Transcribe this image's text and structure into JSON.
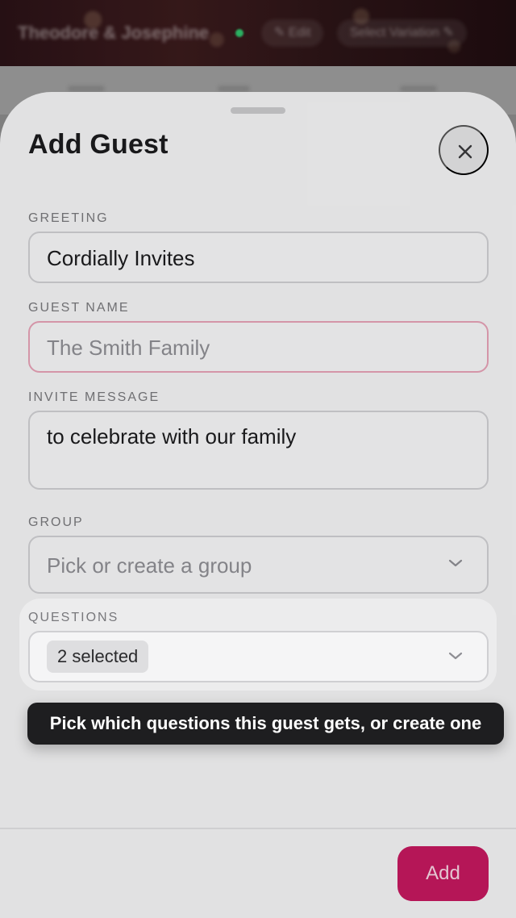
{
  "background": {
    "event_title": "Theodore & Josephine",
    "edit_label": "✎ Edit",
    "variation_label": "Select Variation ✎"
  },
  "sheet": {
    "title": "Add Guest",
    "close_icon": "close-icon",
    "fields": {
      "greeting": {
        "label": "GREETING",
        "value": "Cordially Invites"
      },
      "guest_name": {
        "label": "GUEST NAME",
        "placeholder": "The Smith Family",
        "state": "invalid"
      },
      "invite_message": {
        "label": "INVITE MESSAGE",
        "value": "to celebrate with our family"
      },
      "group": {
        "label": "GROUP",
        "placeholder": "Pick or create a group"
      },
      "questions": {
        "label": "QUESTIONS",
        "selected_chip": "2 selected"
      }
    },
    "tooltip": "Pick which questions this guest gets, or create one",
    "add_button": "Add"
  },
  "colors": {
    "accent": "#c4185f",
    "error_border": "#e6a1b6",
    "tooltip_bg": "#1e1e20"
  }
}
